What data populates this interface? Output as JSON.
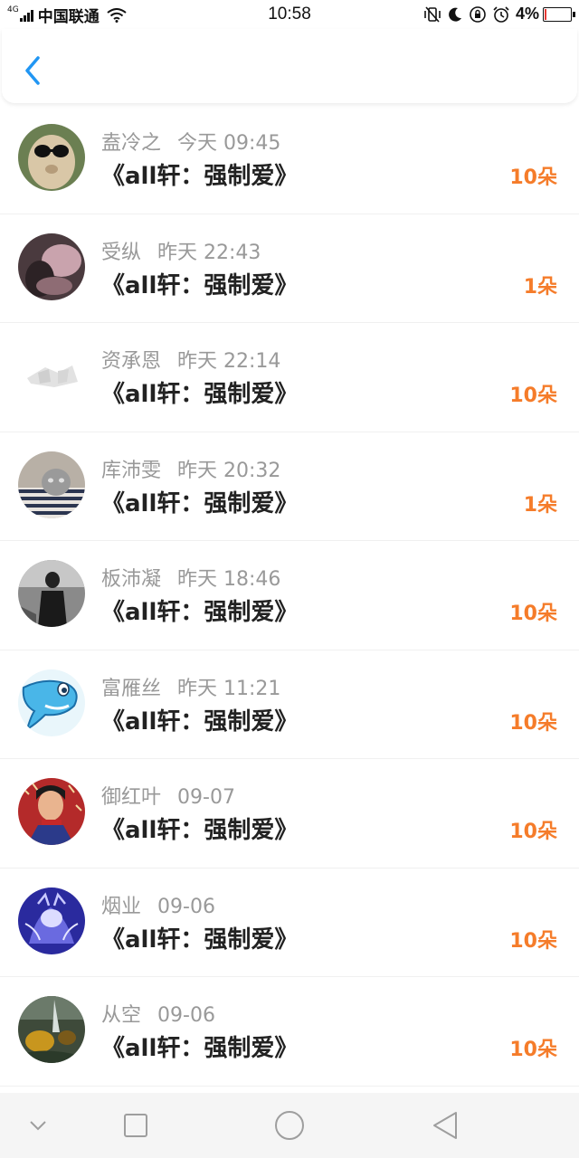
{
  "status_bar": {
    "network": "4G",
    "carrier": "中国联通",
    "time": "10:58",
    "battery": "4%"
  },
  "header": {
    "back_icon": "chevron-left-icon",
    "accent": "#2196f3"
  },
  "colors": {
    "flower_count": "#f57c2a",
    "meta_text": "#999999"
  },
  "items": [
    {
      "name": "盍冷之",
      "time": "今天 09:45",
      "title": "《all轩：强制爱》",
      "flowers": "10朵"
    },
    {
      "name": "受纵",
      "time": "昨天 22:43",
      "title": "《all轩：强制爱》",
      "flowers": "1朵"
    },
    {
      "name": "资承恩",
      "time": "昨天 22:14",
      "title": "《all轩：强制爱》",
      "flowers": "10朵"
    },
    {
      "name": "库沛雯",
      "time": "昨天 20:32",
      "title": "《all轩：强制爱》",
      "flowers": "1朵"
    },
    {
      "name": "板沛凝",
      "time": "昨天 18:46",
      "title": "《all轩：强制爱》",
      "flowers": "10朵"
    },
    {
      "name": "富雁丝",
      "time": "昨天 11:21",
      "title": "《all轩：强制爱》",
      "flowers": "10朵"
    },
    {
      "name": "御红叶",
      "time": "09-07",
      "title": "《all轩：强制爱》",
      "flowers": "10朵"
    },
    {
      "name": "烟业",
      "time": "09-06",
      "title": "《all轩：强制爱》",
      "flowers": "10朵"
    },
    {
      "name": "从空",
      "time": "09-06",
      "title": "《all轩：强制爱》",
      "flowers": "10朵"
    }
  ],
  "system_nav": {
    "icons": [
      "chevron-down-icon",
      "square-icon",
      "circle-icon",
      "triangle-back-icon"
    ]
  }
}
